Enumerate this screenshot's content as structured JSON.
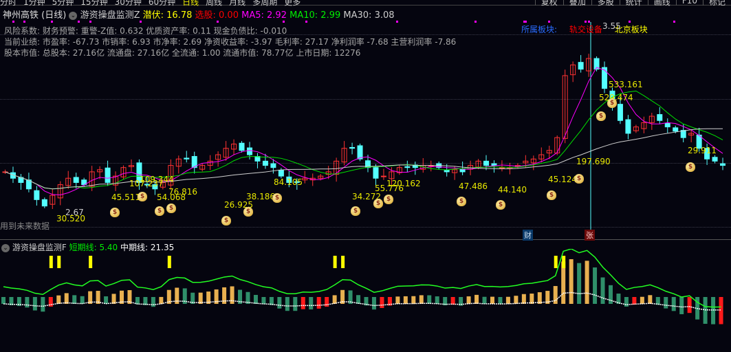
{
  "toolbar": {
    "periods": [
      "分时",
      "1分钟",
      "5分钟",
      "15分钟",
      "30分钟",
      "60分钟",
      "日线",
      "周线",
      "月线",
      "多周期",
      "更多"
    ],
    "active": "日线",
    "right": [
      "复权",
      "叠加",
      "多股",
      "统计",
      "画线",
      "F10",
      "标记"
    ]
  },
  "header": {
    "title": "神州高铁 (日线)",
    "indicator": "游资操盘监测Z",
    "qf_label": "潜伏:",
    "qf": "16.78",
    "xg_label": "选股:",
    "xg": "0.00",
    "ma5_label": "MA5:",
    "ma5": "2.92",
    "ma10_label": "MA10:",
    "ma10": "2.99",
    "ma30_label": "MA30:",
    "ma30": "3.08"
  },
  "info": [
    "风险系数: 财务预警: 重警-Z值: 0.632 优质资产率: 0.11 现金负债比: -0.010",
    "当前业绩: 市盈率: -67.73 市销率: 6.93 市净率: 2.69 净资收益率: -3.97 毛利率: 27.17 净利润率 -7.68 主营利润率 -7.86",
    "股本市值: 总股本: 27.16亿 流通盘: 27.16亿 全流通: 1.00 流通市值: 78.77亿 上市日期: 12276"
  ],
  "sector": {
    "label": "所属板块:",
    "s1": "轨交设备",
    "s2": "北京板块",
    "high": "3.55",
    "low": "2.67"
  },
  "future_note": "用到未来数据",
  "markers": {
    "cai": "财",
    "zhang": "张"
  },
  "labels": [
    "30.520",
    "45.511",
    "107.237",
    "109.344",
    "54.068",
    "76.816",
    "26.925",
    "38.186",
    "84.105",
    "34.272",
    "55.776",
    "120.162",
    "47.486",
    "44.140",
    "45.124",
    "197.690",
    "529.474",
    "533.161",
    "29.911"
  ],
  "lower": {
    "indicator": "游资操盘监测F",
    "short_label": "短期线:",
    "short": "5.40",
    "mid_label": "中期线:",
    "mid": "21.35"
  },
  "closes": [
    2.86,
    2.83,
    2.81,
    2.78,
    2.73,
    2.7,
    2.75,
    2.8,
    2.83,
    2.81,
    2.8,
    2.86,
    2.87,
    2.81,
    2.84,
    2.88,
    2.89,
    2.81,
    2.8,
    2.78,
    2.81,
    2.89,
    2.92,
    2.92,
    2.88,
    2.89,
    2.91,
    2.94,
    2.97,
    2.99,
    2.96,
    2.94,
    2.91,
    2.89,
    2.88,
    2.84,
    2.81,
    2.81,
    2.83,
    2.83,
    2.84,
    2.86,
    2.91,
    2.97,
    2.97,
    2.92,
    2.88,
    2.83,
    2.84,
    2.86,
    2.88,
    2.88,
    2.88,
    2.89,
    2.89,
    2.88,
    2.86,
    2.87,
    2.86,
    2.89,
    2.91,
    2.89,
    2.89,
    2.88,
    2.88,
    2.89,
    2.91,
    2.92,
    2.94,
    2.96,
    3.02,
    3.31,
    3.36,
    3.34,
    3.39,
    3.34,
    3.25,
    3.18,
    3.1,
    3.04,
    3.07,
    3.09,
    3.12,
    3.1,
    3.07,
    3.05,
    3.02,
    3.04,
    2.97,
    2.92,
    2.91,
    2.89
  ],
  "colors": {
    "up": "#ff3232",
    "down": "#54ffff",
    "ma5": "#ff00ff",
    "ma10": "#00e000",
    "ma30": "#d0d0d0"
  }
}
